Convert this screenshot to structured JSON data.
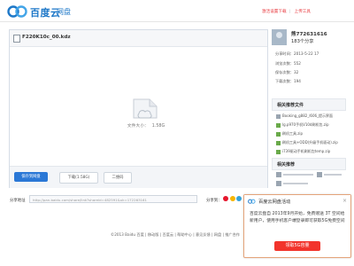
{
  "header": {
    "logo_text": "百度云",
    "logo_sub": "网盘",
    "nav": [
      "激活设置下载",
      "上传工具"
    ],
    "accent_color": "#1e78c8"
  },
  "file": {
    "name": "F220K10c_00.kdz",
    "size_label": "文件大小：",
    "size_value": "1.58G"
  },
  "actions": {
    "save": "保存到网盘",
    "download": "下载(1.58G)",
    "qr": "二维码"
  },
  "share": {
    "address_label": "分享地址",
    "address_value": "http://pan.baidu.com/share/link?shareid=482591&uk=172263161",
    "share_to_label": "分享到："
  },
  "user": {
    "name": "熊772631616",
    "shared": "183个分享",
    "meta": [
      "分享时间：2013-5-22 17",
      "浏览次数：552",
      "保存次数：32",
      "下载次数：194"
    ]
  },
  "recommend": {
    "title": "相关推荐文件",
    "items": [
      "Booking_g882_l606_提示界面",
      "lg.p970手机V10d刷机包.zip",
      "刷机工具.zip",
      "刷机工具+ODD(升级手机驱动).zip",
      "i739驱动手机刷机包temp.zip"
    ]
  },
  "more": {
    "title": "相关推荐"
  },
  "popup": {
    "title": "百度云网盘活动",
    "body": "百度云盘自 2013年9月开始，免费赠送 3T 空间给新用户，使用手机客户端登录即可获取5G免费空间",
    "button": "领取5G容量"
  },
  "footer": {
    "text": "©2013 Baidu 百度 | 移动版 | 百度云 | 帮助中心 | 意见反馈 | 网盘 | 推广合作"
  }
}
